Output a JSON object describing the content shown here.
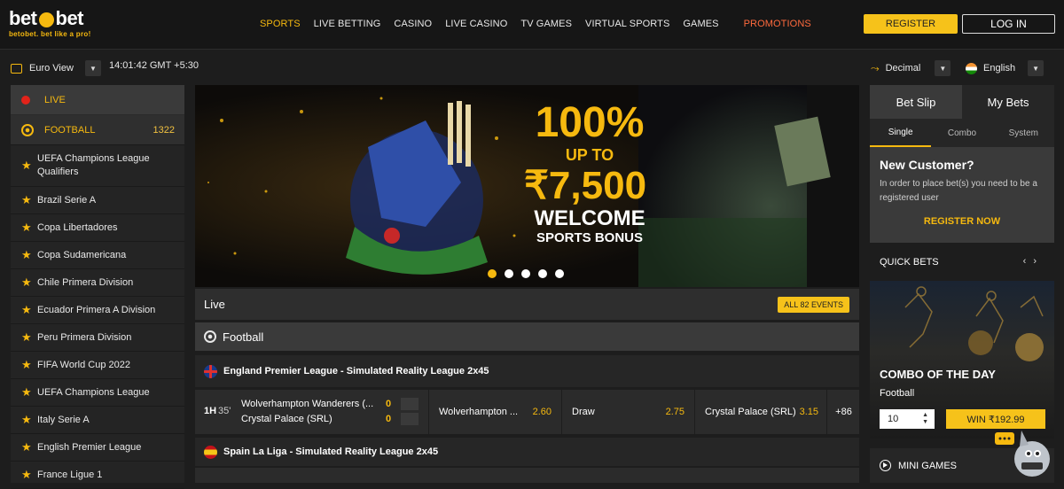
{
  "brand": {
    "name_left": "bet",
    "name_right": "bet",
    "tagline": "betobet. bet like a pro!",
    "accent": "#f6b90f",
    "promo_color": "#ff6a3d"
  },
  "nav": {
    "items": [
      "SPORTS",
      "LIVE BETTING",
      "CASINO",
      "LIVE CASINO",
      "TV GAMES",
      "VIRTUAL SPORTS",
      "GAMES"
    ],
    "promotions": "PROMOTIONS",
    "register": "REGISTER",
    "login": "LOG IN"
  },
  "subbar": {
    "view": "Euro View",
    "time": "14:01:42 GMT +5:30",
    "odds_format": "Decimal",
    "language": "English"
  },
  "sidebar": {
    "live": "LIVE",
    "football": {
      "label": "FOOTBALL",
      "count": "1322"
    },
    "leagues": [
      "UEFA Champions League Qualifiers",
      "Brazil Serie A",
      "Copa Libertadores",
      "Copa Sudamericana",
      "Chile Primera Division",
      "Ecuador Primera A Division",
      "Peru Primera Division",
      "FIFA World Cup 2022",
      "UEFA Champions League",
      "Italy Serie A",
      "English Premier League",
      "France Ligue 1"
    ]
  },
  "banner": {
    "line1": "100%",
    "line2": "UP TO",
    "line3": "₹7,500",
    "line4": "WELCOME",
    "line5": "SPORTS BONUS",
    "slides": 5,
    "active_slide": 1
  },
  "live_section": {
    "title": "Live",
    "all_events": "ALL 82 EVENTS",
    "sport": "Football"
  },
  "league1": {
    "name": "England Premier League - Simulated Reality League 2x45"
  },
  "match1": {
    "period": "1H",
    "minute": "35'",
    "home": "Wolverhampton Wanderers (...",
    "away": "Crystal Palace (SRL)",
    "home_score": "0",
    "away_score": "0",
    "odds": [
      {
        "label": "Wolverhampton ...",
        "value": "2.60"
      },
      {
        "label": "Draw",
        "value": "2.75"
      },
      {
        "label": "Crystal Palace (SRL)",
        "value": "3.15"
      }
    ],
    "more": "+86"
  },
  "league2": {
    "name": "Spain La Liga - Simulated Reality League 2x45"
  },
  "betslip": {
    "tabs": [
      "Bet Slip",
      "My Bets"
    ],
    "subtabs": [
      "Single",
      "Combo",
      "System"
    ],
    "new_customer_title": "New Customer?",
    "new_customer_text": "In order to place bet(s) you need to be a registered user",
    "register_now": "REGISTER NOW"
  },
  "quick_bets": {
    "title": "QUICK BETS",
    "combo_title": "COMBO OF THE DAY",
    "combo_sport": "Football",
    "stake": "10",
    "win": "WIN ₹192.99"
  },
  "mini_games": {
    "title": "MINI GAMES"
  }
}
